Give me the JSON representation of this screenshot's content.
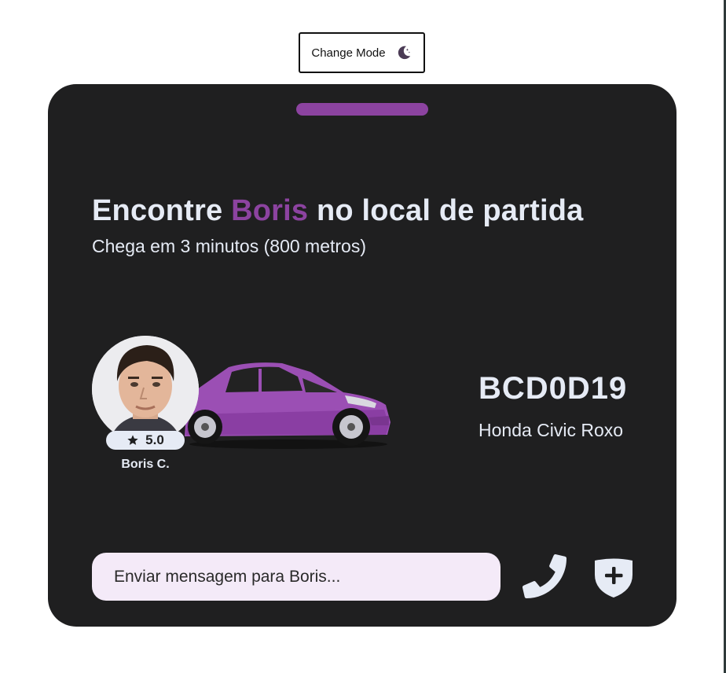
{
  "mode_button": {
    "label": "Change Mode",
    "icon": "moon-stars-icon"
  },
  "trip": {
    "title_prefix": "Encontre ",
    "driver_highlight": "Boris",
    "title_suffix": " no local de partida",
    "subtitle": "Chega em 3 minutos (800 metros)"
  },
  "driver": {
    "name": "Boris C.",
    "rating": "5.0",
    "rating_icon": "star-icon",
    "avatar_icon": "driver-avatar"
  },
  "vehicle": {
    "plate": "BCD0D19",
    "model": "Honda Civic Roxo",
    "color": "#8c43a0",
    "image": "car-illustration"
  },
  "chat": {
    "placeholder": "Enviar mensagem para Boris..."
  },
  "actions": {
    "call_icon": "phone-icon",
    "safety_icon": "shield-plus-icon"
  },
  "colors": {
    "card_background": "#1f1f20",
    "accent": "#8c43a0",
    "text_light": "#e6ebf5",
    "input_background": "#f4eaf8"
  }
}
